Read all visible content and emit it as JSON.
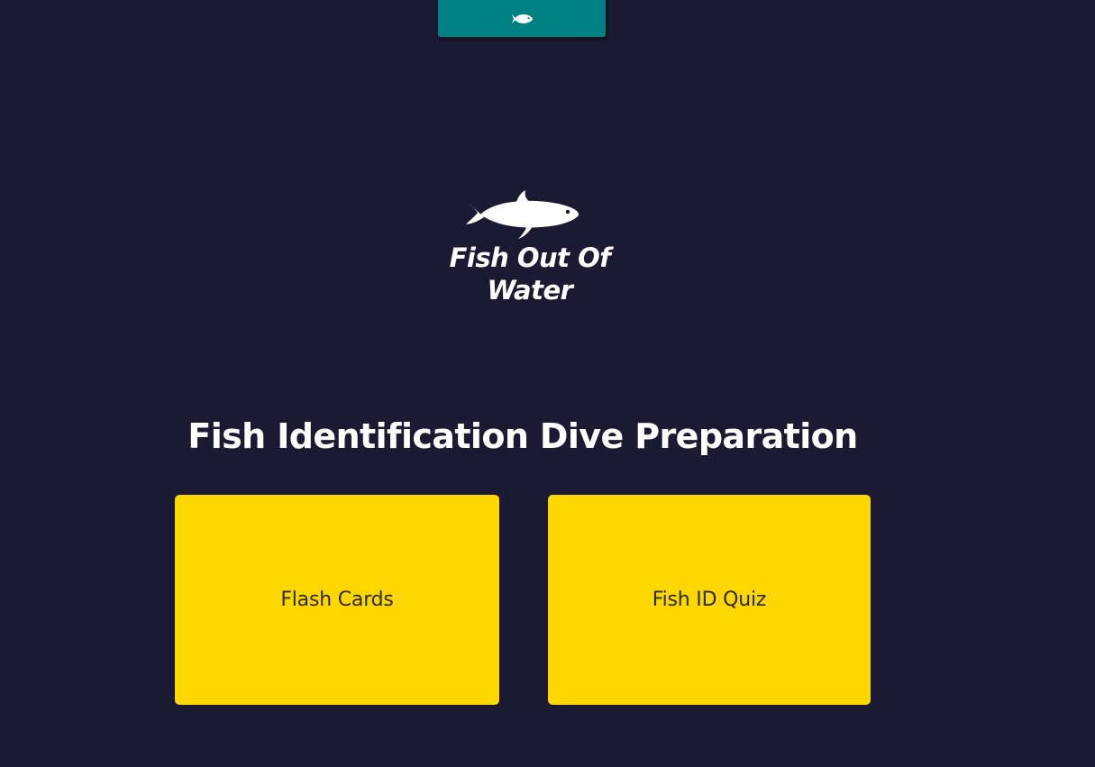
{
  "nav": {
    "menu_icon": "fish-icon",
    "background_color": "#008080"
  },
  "logo": {
    "icon": "fish-icon",
    "line1": "Fish Out Of",
    "line2": "Water"
  },
  "page": {
    "title": "Fish Identification Dive Preparation",
    "background_color": "#1c1a33"
  },
  "cards": {
    "accent_color": "#ffd700",
    "flash_cards_label": "Flash Cards",
    "fish_id_quiz_label": "Fish ID Quiz"
  }
}
